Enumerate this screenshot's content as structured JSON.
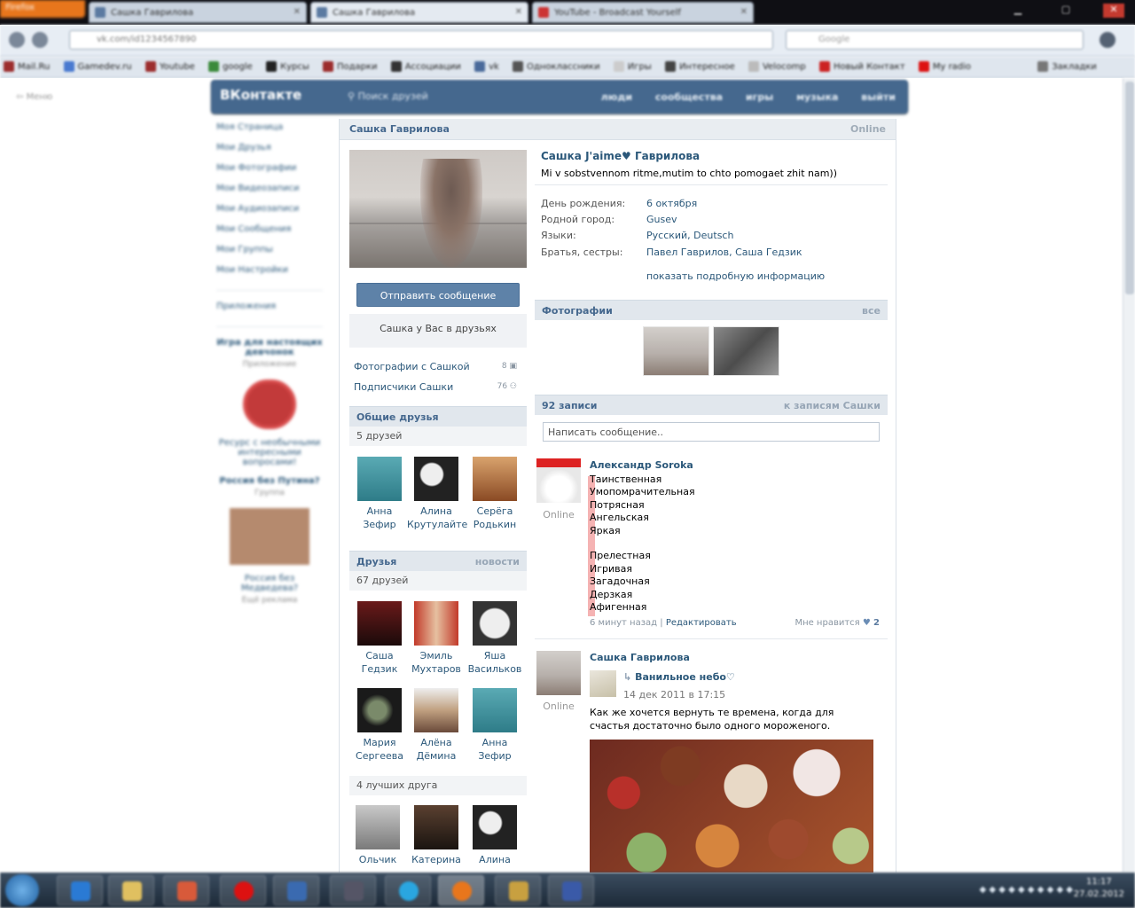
{
  "browser": {
    "menu_button": "Firefox",
    "tabs": [
      {
        "label": "Сашка Гаврилова"
      },
      {
        "label": "Сашка Гаврилова"
      },
      {
        "label": "YouTube - Broadcast Yourself"
      }
    ],
    "url": "vk.com/id1234567890",
    "search_placeholder": "Google",
    "bookmarks": [
      "Mail.Ru",
      "Gamedev.ru",
      "Youtube",
      "google",
      "Курсы",
      "Подарки",
      "Ассоциации",
      "vk",
      "Одноклассники",
      "Игры",
      "Интересное",
      "Velocomp",
      "Новый Контакт",
      "My radio",
      "Закладки"
    ]
  },
  "vk": {
    "logo": "ВКонтакте",
    "search_label": "Поиск друзей",
    "header_links": [
      "люди",
      "сообщества",
      "игры",
      "музыка",
      "выйти"
    ],
    "left_menu_toggle": "Меню",
    "left_menu": [
      "Моя Страница",
      "Мои Друзья",
      "Мои Фотографии",
      "Мои Видеозаписи",
      "Мои Аудиозаписи",
      "Мои Сообщения",
      "Мои Группы",
      "Мои Настройки"
    ],
    "left_apps": "Приложения",
    "ads": [
      {
        "title": "Игра для настоящих девчонок",
        "sub": "Приложение"
      },
      {
        "title": "Ресурс с необычными интересными вопросами!"
      },
      {
        "title": "Россия без Путина?",
        "sub": "Группа"
      },
      {
        "title": "Россия без Медведева?"
      }
    ],
    "ads_more": "Ещё реклама"
  },
  "profile": {
    "title_name": "Сашка Гаврилова",
    "online": "Online",
    "full_name": "Сашка J'aime♥ Гаврилова",
    "status": "Mi v sobstvennom ritme,mutim to chto pomogaet zhit nam))",
    "send_message": "Отправить сообщение",
    "friend_note": "Сашка у Вас в друзьях",
    "info": [
      {
        "label": "День рождения:",
        "value": "6 октября"
      },
      {
        "label": "Родной город:",
        "value": "Gusev"
      },
      {
        "label": "Языки:",
        "value": "Русский, Deutsch"
      },
      {
        "label": "Братья, сестры:",
        "value": "Павел Гаврилов, Саша Гедзик"
      }
    ],
    "more_info": "показать подробную информацию",
    "photos_with": {
      "label": "Фотографии с Сашкой",
      "count": "8"
    },
    "followers": {
      "label": "Подписчики Сашки",
      "count": "76"
    }
  },
  "common_friends": {
    "title": "Общие друзья",
    "count": "5 друзей",
    "items": [
      {
        "first": "Анна",
        "last": "Зефир",
        "color": "#3a8a96"
      },
      {
        "first": "Алина",
        "last": "Крутулайте",
        "color": "#555555"
      },
      {
        "first": "Серёга",
        "last": "Родькин",
        "color": "#a0552c"
      }
    ]
  },
  "friends": {
    "title": "Друзья",
    "news": "новости",
    "count": "67 друзей",
    "items": [
      {
        "first": "Саша",
        "last": "Гедзик",
        "color": "#4a1414"
      },
      {
        "first": "Эмиль",
        "last": "Мухтаров",
        "color": "#b23a2a"
      },
      {
        "first": "Яша",
        "last": "Васильков",
        "color": "#7a7a7a"
      },
      {
        "first": "Мария",
        "last": "Сергеева",
        "color": "#2a2a2a"
      },
      {
        "first": "Алёна",
        "last": "Дёмина",
        "color": "#c0a080"
      },
      {
        "first": "Анна",
        "last": "Зефир",
        "color": "#3a8a96"
      }
    ],
    "best_title": "4 лучших друга",
    "best": [
      {
        "first": "Ольчик",
        "color": "#9a9a9a"
      },
      {
        "first": "Катерина",
        "color": "#3a2a22"
      },
      {
        "first": "Алина",
        "color": "#555555"
      }
    ]
  },
  "photos": {
    "title": "Фотографии",
    "all": "все"
  },
  "wall": {
    "count": "92 записи",
    "to_posts": "к записям Сашки",
    "input_placeholder": "Написать сообщение..",
    "post1": {
      "author": "Александр Soroka",
      "online": "Online",
      "lines": [
        "Таинственная",
        "Умопомрачительная",
        "Потрясная",
        "Ангельская",
        "Яркая",
        "",
        "Прелестная",
        "Игривая",
        "Загадочная",
        "Дерзкая",
        "Афигенная"
      ],
      "time": "6 минут назад",
      "sep": "|",
      "edit": "Редактировать",
      "like": "Мне нравится",
      "like_count": "2"
    },
    "post2": {
      "author": "Сашка Гаврилова",
      "online": "Online",
      "repost_name": "Ванильное небо♡",
      "repost_date": "14 дек 2011 в 17:15",
      "text": "Как же хочется вернуть те времена, когда для счастья достаточно было одного мороженого."
    }
  },
  "taskbar": {
    "clock_time": "11:17",
    "clock_date": "27.02.2012"
  }
}
